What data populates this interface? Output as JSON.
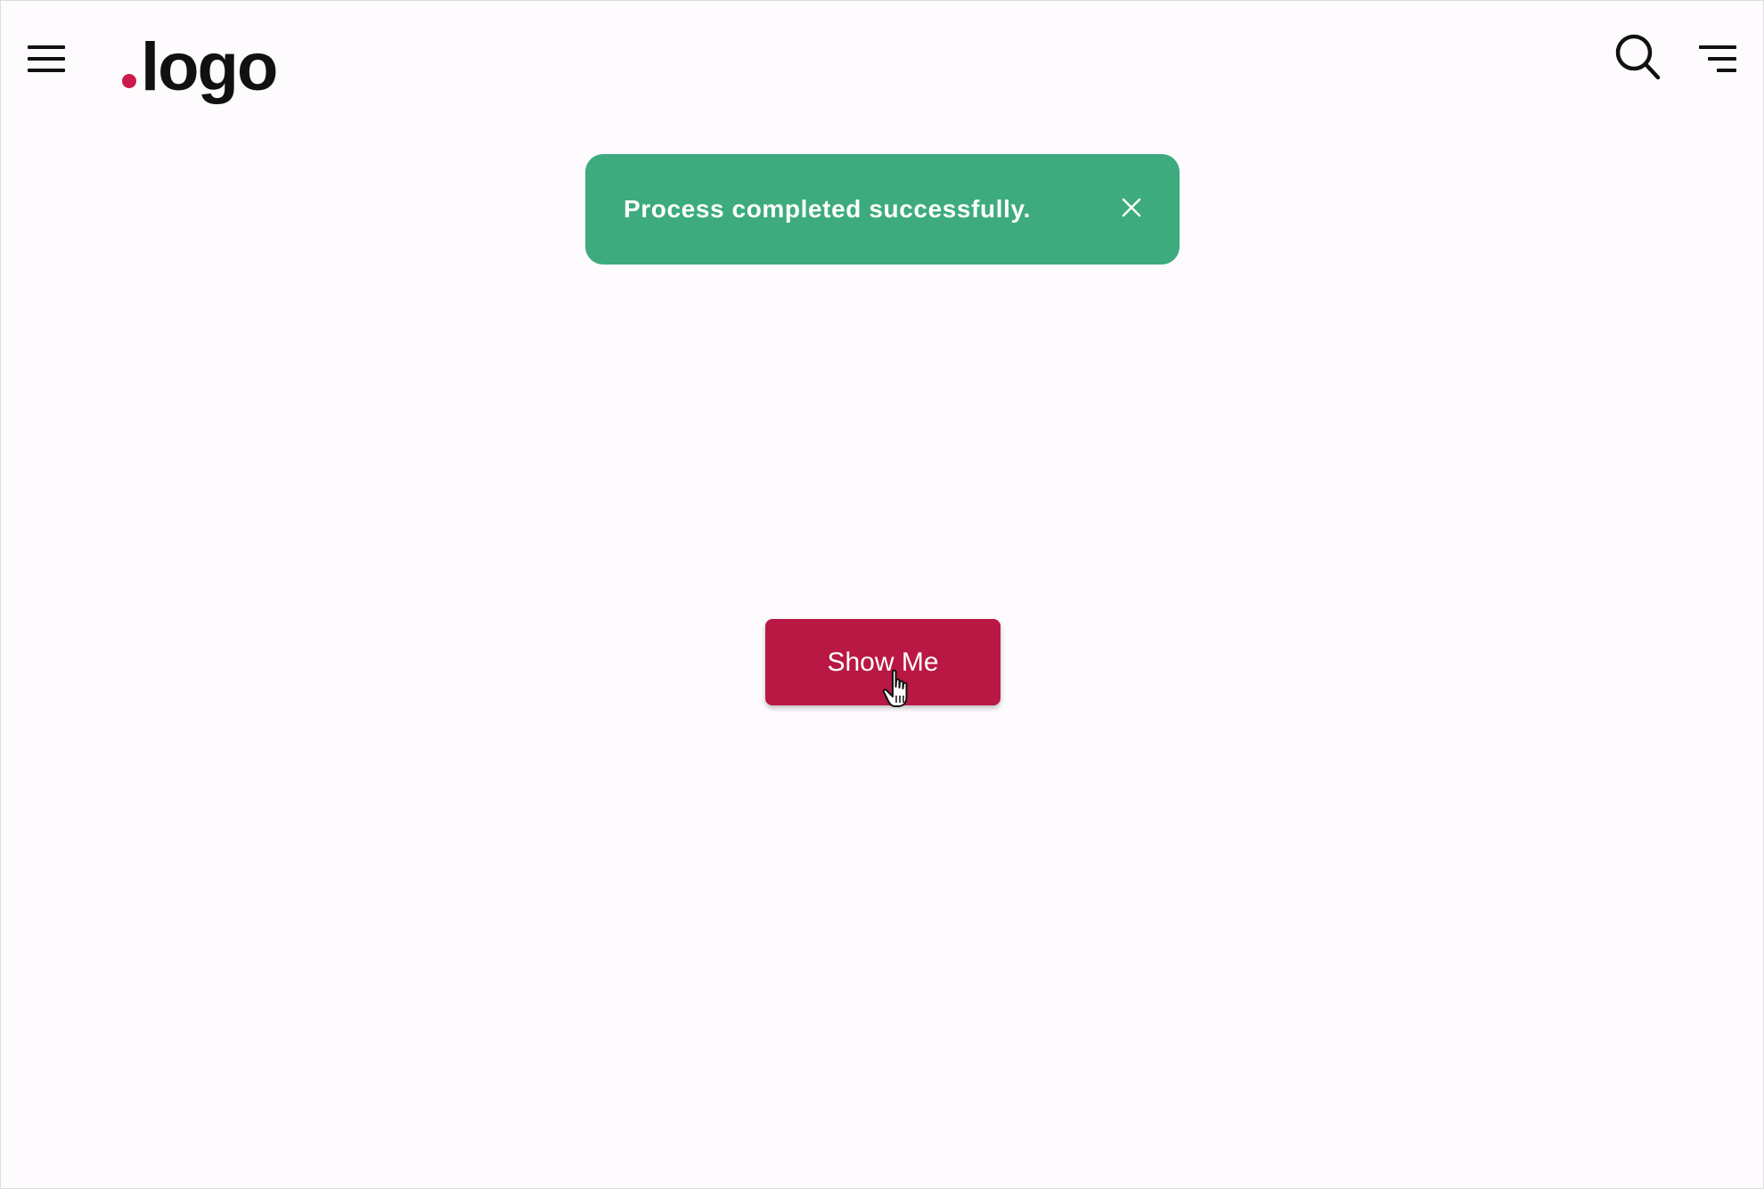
{
  "header": {
    "menu_icon": "hamburger-menu-icon",
    "logo_text": "logo",
    "logo_dot_color": "#cc1a4b",
    "search_icon": "search-icon",
    "filter_icon": "filter-lines-icon"
  },
  "toast": {
    "message": "Process completed successfully.",
    "close_icon": "close-icon",
    "background_color": "#3dab7d"
  },
  "main": {
    "button_label": "Show Me",
    "button_color": "#b91844",
    "cursor_icon": "hand-pointer-cursor-icon"
  }
}
